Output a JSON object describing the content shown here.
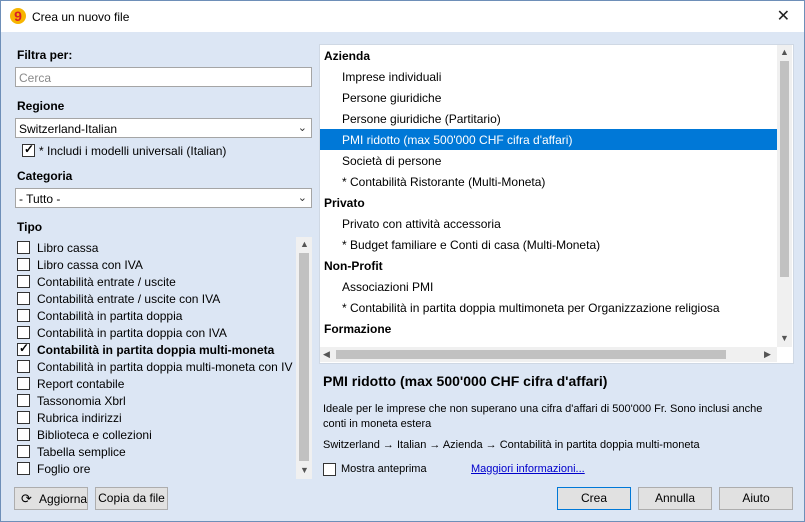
{
  "window": {
    "title": "Crea un nuovo file",
    "close_icon": "close-icon",
    "app_icon": "app-logo-9"
  },
  "filter": {
    "label": "Filtra per:",
    "search_placeholder": "Cerca"
  },
  "region": {
    "label": "Regione",
    "selected": "Switzerland-Italian",
    "include_universal": {
      "label": "* Includi i modelli universali (Italian)",
      "checked": true
    }
  },
  "category": {
    "label": "Categoria",
    "selected": "- Tutto -"
  },
  "types": {
    "label": "Tipo",
    "items": [
      {
        "label": "Libro cassa",
        "checked": false
      },
      {
        "label": "Libro cassa con IVA",
        "checked": false
      },
      {
        "label": "Contabilità entrate / uscite",
        "checked": false
      },
      {
        "label": "Contabilità entrate / uscite con IVA",
        "checked": false
      },
      {
        "label": "Contabilità in partita doppia",
        "checked": false
      },
      {
        "label": "Contabilità in partita doppia con IVA",
        "checked": false
      },
      {
        "label": "Contabilità in partita doppia multi-moneta",
        "checked": true
      },
      {
        "label": "Contabilità in partita doppia multi-moneta con IV",
        "checked": false
      },
      {
        "label": "Report contabile",
        "checked": false
      },
      {
        "label": "Tassonomia Xbrl",
        "checked": false
      },
      {
        "label": "Rubrica indirizzi",
        "checked": false
      },
      {
        "label": "Biblioteca e collezioni",
        "checked": false
      },
      {
        "label": "Tabella semplice",
        "checked": false
      },
      {
        "label": "Foglio ore",
        "checked": false
      }
    ]
  },
  "buttons": {
    "refresh": "Aggiorna",
    "copy_from_file": "Copia da file",
    "create": "Crea",
    "cancel": "Annulla",
    "help": "Aiuto"
  },
  "templates": [
    {
      "kind": "group",
      "label": "Azienda"
    },
    {
      "kind": "item",
      "label": "Imprese individuali"
    },
    {
      "kind": "item",
      "label": "Persone giuridiche"
    },
    {
      "kind": "item",
      "label": "Persone giuridiche (Partitario)"
    },
    {
      "kind": "item",
      "label": "PMI ridotto (max 500'000 CHF cifra d'affari)",
      "selected": true
    },
    {
      "kind": "item",
      "label": "Società di persone"
    },
    {
      "kind": "item",
      "label": "* Contabilità Ristorante (Multi-Moneta)"
    },
    {
      "kind": "group",
      "label": "Privato"
    },
    {
      "kind": "item",
      "label": "Privato con attività accessoria"
    },
    {
      "kind": "item",
      "label": "* Budget familiare e Conti di casa (Multi-Moneta)"
    },
    {
      "kind": "group",
      "label": "Non-Profit"
    },
    {
      "kind": "item",
      "label": "Associazioni PMI"
    },
    {
      "kind": "item",
      "label": "* Contabilità in partita doppia multimoneta per Organizzazione religiosa"
    },
    {
      "kind": "group",
      "label": "Formazione"
    }
  ],
  "detail": {
    "title": "PMI ridotto (max 500'000 CHF cifra d'affari)",
    "description": "Ideale per le imprese che non superano una cifra d'affari di 500'000 Fr. Sono inclusi anche conti in moneta estera",
    "path": "Switzerland → Italian → Azienda → Contabilità in partita doppia multi-moneta",
    "preview_label": "Mostra anteprima",
    "preview_checked": false,
    "more_info": "Maggiori informazioni..."
  },
  "colors": {
    "accent": "#0078d7",
    "dialog_bg": "#dce6f4"
  }
}
